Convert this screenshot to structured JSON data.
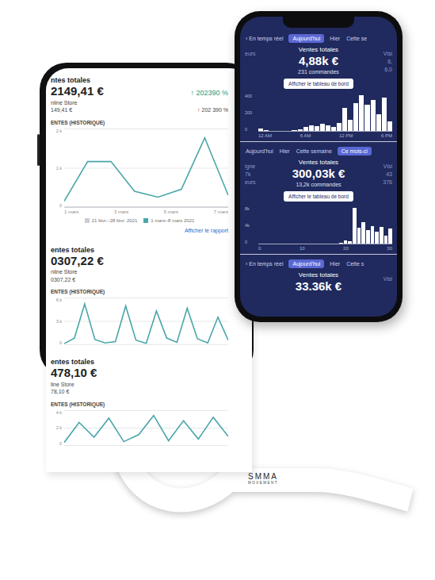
{
  "left_phone": {
    "blocks": [
      {
        "title": "ntes totales",
        "value": "2149,41 €",
        "change": "↑ 202390 %",
        "store": "nline Store",
        "store_value": "149,41 €",
        "store_change": "↑ 202 390 %",
        "chart_title": "ENTES (HISTORIQUE)",
        "chart": {
          "y_ticks": [
            "2 k",
            "1 k",
            "0"
          ],
          "x_ticks": [
            "1 mars",
            "3 mars",
            "5 mars",
            "7 mars"
          ],
          "series": [
            {
              "name": "21 févr.–28 févr. 2021",
              "color": "#c9cdd1",
              "values": [
                0,
                0,
                0,
                0,
                0,
                0,
                0,
                0
              ]
            },
            {
              "name": "1 mars–8 mars 2021",
              "color": "#4aa6a9",
              "values": [
                150,
                1150,
                1150,
                400,
                250,
                450,
                1750,
                300
              ]
            }
          ]
        },
        "link": "Afficher le rapport"
      },
      {
        "title": "entes totales",
        "value": "0307,22 €",
        "change": "",
        "store": "nline Store",
        "store_value": "0307,22 €",
        "store_change": "",
        "chart_title": "ENTES (HISTORIQUE)",
        "chart": {
          "y_ticks": [
            "6 k",
            "3 k",
            "0"
          ],
          "x_ticks": [],
          "series": [
            {
              "color": "#4aa6a9",
              "values": [
                100,
                900,
                5800,
                700,
                200,
                400,
                5500,
                600,
                150,
                4800,
                900,
                300,
                5200,
                800,
                200,
                3900,
                600
              ]
            }
          ]
        },
        "link": ""
      },
      {
        "title": "entes totales",
        "value": "478,10 €",
        "change": "",
        "store": "line Store",
        "store_value": "78,10 €",
        "store_change": "",
        "chart_title": "ENTES (HISTORIQUE)",
        "chart": {
          "y_ticks": [
            "4 k",
            "2 k",
            "0"
          ],
          "x_ticks": [],
          "series": [
            {
              "color": "#4aa6a9",
              "values": [
                300,
                2600,
                900,
                3100,
                400,
                1200,
                3400,
                500,
                2800,
                700,
                3200,
                1000
              ]
            }
          ]
        },
        "link": ""
      }
    ]
  },
  "right_phone": {
    "sections": [
      {
        "tabs": [
          {
            "label": "‹ En temps réel",
            "selected": false
          },
          {
            "label": "Aujourd'hui",
            "selected": true
          },
          {
            "label": "Hier",
            "selected": false
          },
          {
            "label": "Cette se",
            "selected": false
          }
        ],
        "left_side": [
          "eurs"
        ],
        "right_side": [
          "Visi",
          "6,",
          "6,0"
        ],
        "title": "Ventes totales",
        "value": "4,88k €",
        "orders": "231 commandes",
        "button": "Afficher le tableau de bord",
        "chart": {
          "y_ticks": [
            "400",
            "200",
            "0"
          ],
          "x_ticks": [
            "12 AM",
            "6 AM",
            "12 PM",
            "6 PM"
          ],
          "values": [
            30,
            10,
            0,
            0,
            0,
            0,
            10,
            20,
            40,
            60,
            50,
            80,
            60,
            40,
            90,
            250,
            120,
            300,
            380,
            280,
            330,
            180,
            360,
            100
          ]
        }
      },
      {
        "tabs": [
          {
            "label": "Aujourd'hui",
            "selected": false
          },
          {
            "label": "Hier",
            "selected": false
          },
          {
            "label": "Cette semaine",
            "selected": false
          },
          {
            "label": "Ce mois-ci",
            "selected": true
          }
        ],
        "left_side": [
          "igne",
          "7k",
          "eurs"
        ],
        "right_side": [
          "Visi",
          "43",
          "376"
        ],
        "title": "Ventes totales",
        "value": "300,03k €",
        "orders": "13,2k commandes",
        "button": "Afficher le tableau de bord",
        "chart": {
          "y_ticks": [
            "8k",
            "4k",
            "0"
          ],
          "x_ticks": [
            "0",
            "10",
            "20",
            "30"
          ],
          "values": [
            0,
            0,
            0,
            0,
            0,
            0,
            0,
            0,
            0,
            0,
            0,
            0,
            0,
            0,
            0,
            0,
            0,
            0,
            300,
            800,
            600,
            9000,
            4000,
            5500,
            3500,
            4500,
            3000,
            4200,
            2000,
            3800
          ]
        }
      },
      {
        "tabs": [
          {
            "label": "‹ En temps réel",
            "selected": false
          },
          {
            "label": "Aujourd'hui",
            "selected": true
          },
          {
            "label": "Hier",
            "selected": false
          },
          {
            "label": "Cette s",
            "selected": false
          }
        ],
        "left_side": [],
        "right_side": [
          "Visi"
        ],
        "title": "Ventes totales",
        "value": "33.36k €",
        "orders": "",
        "button": "",
        "chart": null
      }
    ]
  },
  "logo": {
    "name": "SMMA",
    "tagline": "MOVEMENT"
  }
}
